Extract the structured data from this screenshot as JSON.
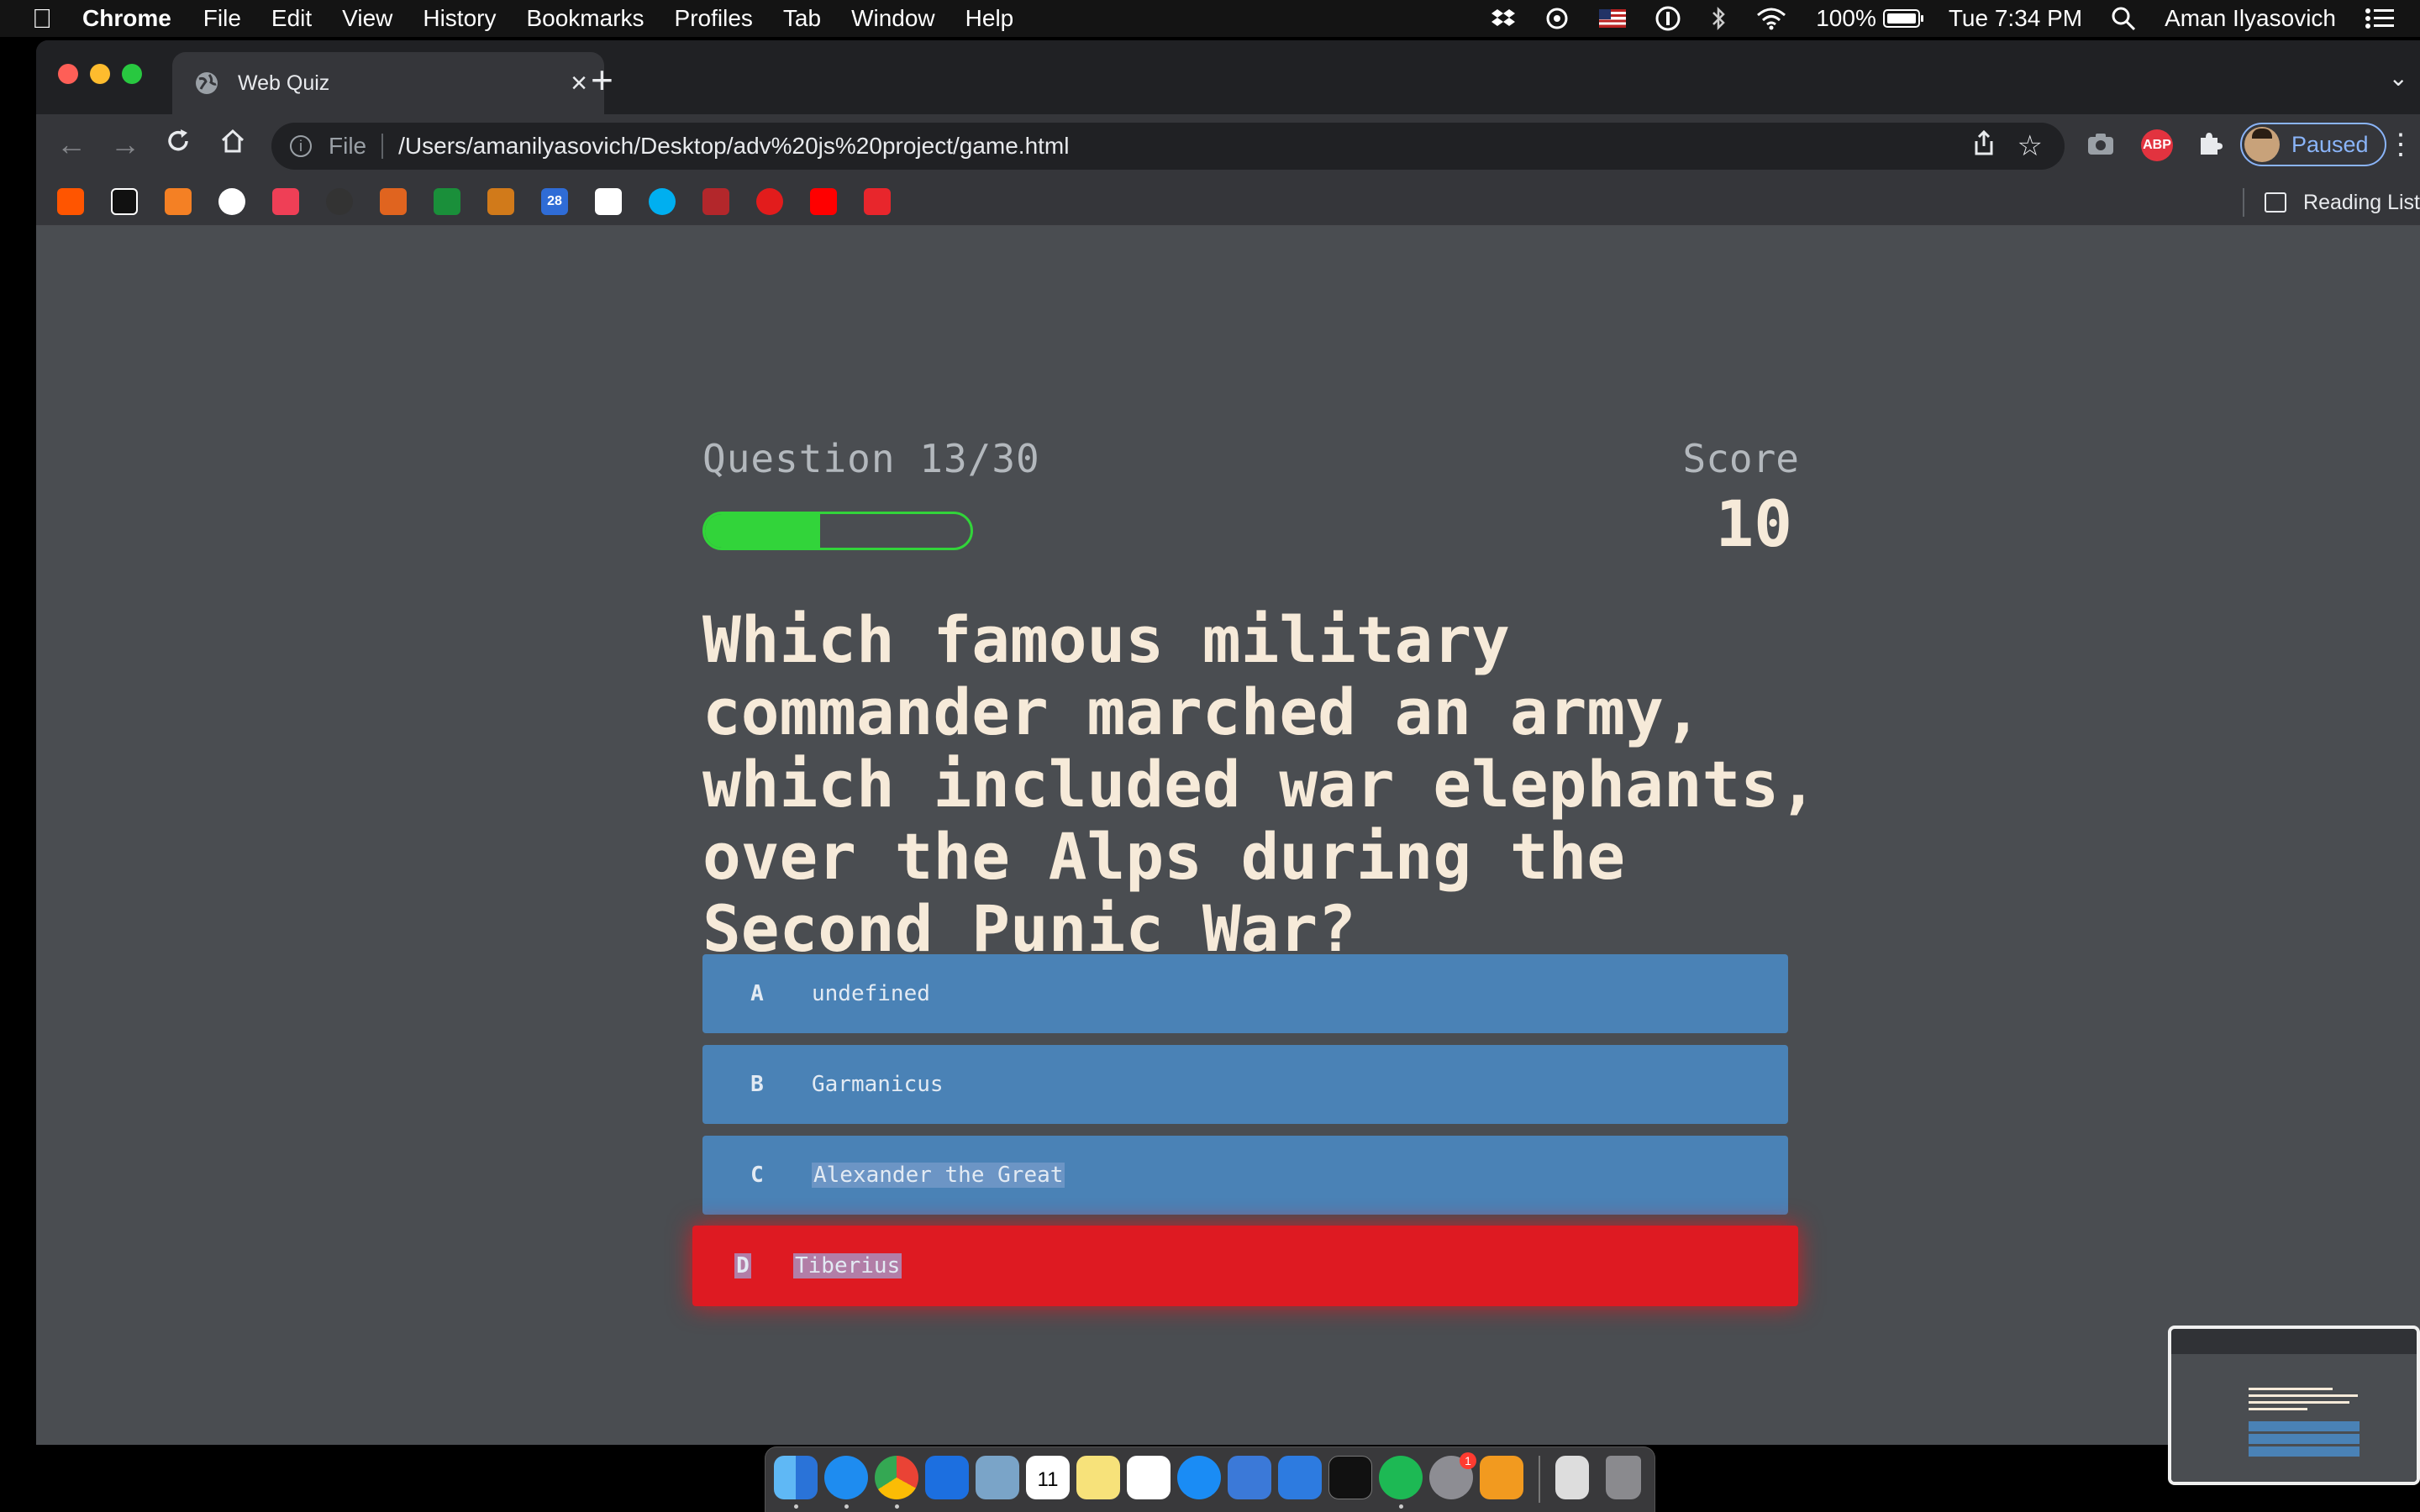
{
  "menubar": {
    "app": "Chrome",
    "items": [
      "File",
      "Edit",
      "View",
      "History",
      "Bookmarks",
      "Profiles",
      "Tab",
      "Window",
      "Help"
    ],
    "battery": "100%",
    "clock": "Tue 7:34 PM",
    "user": "Aman Ilyasovich"
  },
  "browser": {
    "tab_title": "Web Quiz",
    "address_scheme": "File",
    "address": "/Users/amanilyasovich/Desktop/adv%20js%20project/game.html",
    "abp_label": "ABP",
    "profile_status": "Paused",
    "bookmark_badge": "28",
    "reading_list": "Reading List",
    "icons": [
      "back-arrow-icon",
      "forward-arrow-icon",
      "reload-icon",
      "home-icon",
      "info-icon",
      "share-icon",
      "star-icon",
      "camera-icon",
      "extensions-icon",
      "kebab-menu-icon",
      "globe-icon",
      "close-icon",
      "plus-icon"
    ]
  },
  "quiz": {
    "progress_text": "Question 13/30",
    "progress_fraction": 0.433,
    "score_label": "Score",
    "score_value": "10",
    "question": "Which famous military commander marched an army, which included war elephants, over the Alps during the Second Punic War?",
    "choices": [
      {
        "letter": "A",
        "text": "undefined",
        "state": "normal"
      },
      {
        "letter": "B",
        "text": "Garmanicus",
        "state": "normal"
      },
      {
        "letter": "C",
        "text": "Alexander the Great",
        "state": "normal"
      },
      {
        "letter": "D",
        "text": "Tiberius",
        "state": "incorrect"
      }
    ],
    "colors": {
      "background": "#4a4d51",
      "choice": "#4a82b6",
      "incorrect": "#de1a22",
      "progress": "#32d43a",
      "question_text": "#f6ead9"
    }
  },
  "dock": {
    "calendar_day": "11",
    "settings_badge": "1"
  }
}
